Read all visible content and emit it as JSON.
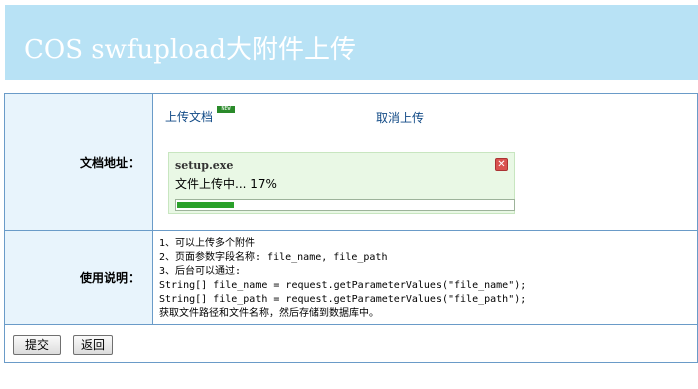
{
  "header": {
    "title": "COS swfupload大附件上传"
  },
  "form": {
    "file_row": {
      "label": "文档地址：",
      "upload_link": "上传文档",
      "new_badge": "NEW",
      "cancel_link": "取消上传",
      "upload_item": {
        "file_name": "setup.exe",
        "status": "文件上传中... 17%",
        "progress_percent": 17
      }
    },
    "instructions_row": {
      "label": "使用说明：",
      "lines": [
        "1、可以上传多个附件",
        "2、页面参数字段名称: file_name, file_path",
        "3、后台可以通过:",
        "String[] file_name = request.getParameterValues(\"file_name\");",
        "String[] file_path = request.getParameterValues(\"file_path\");",
        "获取文件路径和文件名称，然后存储到数据库中。"
      ]
    },
    "buttons": {
      "submit_label": "提交",
      "back_label": "返回"
    }
  },
  "colors": {
    "header_bg": "#b8e2f5",
    "border": "#6a9bc8",
    "label_bg": "#e8f4fc",
    "progress_box_bg": "#e9f8e5",
    "progress_fill": "#2aa02a",
    "link": "#114a86"
  },
  "icons": {
    "close": "close-icon"
  }
}
